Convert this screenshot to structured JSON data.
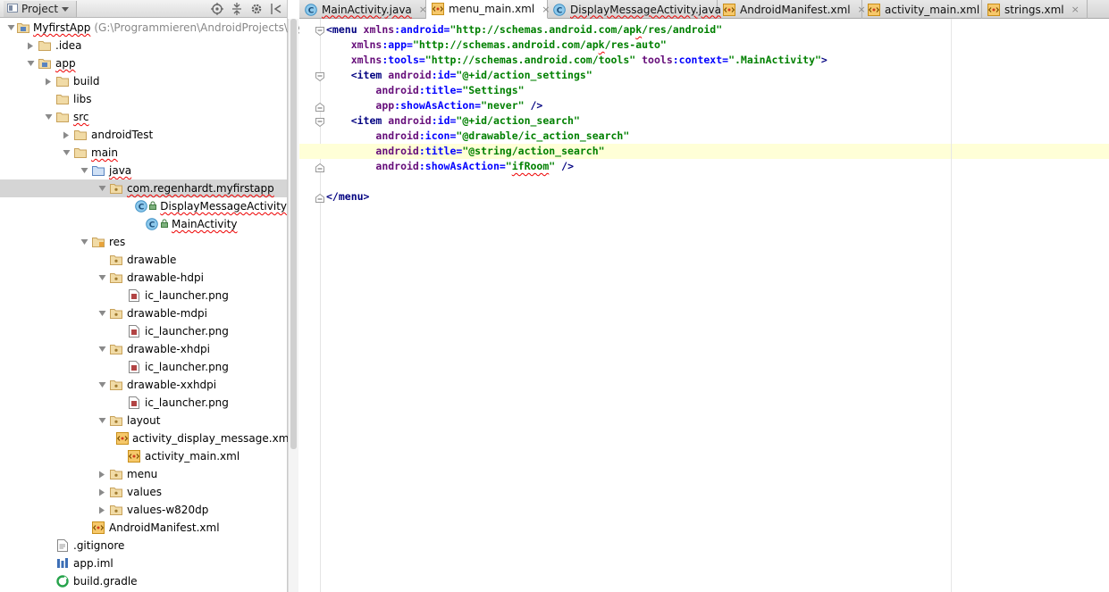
{
  "project_panel": {
    "title": "Project",
    "tools": [
      "target-icon",
      "collapse-icon",
      "gear-icon",
      "hide-icon"
    ]
  },
  "tree": [
    {
      "label": "MyfirstApp",
      "path": "(G:\\Programmieren\\AndroidProjects\\Myf",
      "icon": "module",
      "arrow": "down",
      "indent": 0,
      "squiggle": true
    },
    {
      "label": ".idea",
      "icon": "folder",
      "arrow": "right",
      "indent": 1
    },
    {
      "label": "app",
      "icon": "module",
      "arrow": "down",
      "indent": 1,
      "squiggle": true
    },
    {
      "label": "build",
      "icon": "folder",
      "arrow": "right",
      "indent": 2
    },
    {
      "label": "libs",
      "icon": "folder",
      "arrow": "none",
      "indent": 2
    },
    {
      "label": "src",
      "icon": "folder",
      "arrow": "down",
      "indent": 2,
      "squiggle": true
    },
    {
      "label": "androidTest",
      "icon": "folder",
      "arrow": "right",
      "indent": 3
    },
    {
      "label": "main",
      "icon": "folder",
      "arrow": "down",
      "indent": 3,
      "squiggle": true
    },
    {
      "label": "java",
      "icon": "folder-blue",
      "arrow": "down",
      "indent": 4,
      "squiggle": true
    },
    {
      "label": "com.regenhardt.myfirstapp",
      "icon": "package",
      "arrow": "down",
      "indent": 5,
      "squiggle": true,
      "selected": true
    },
    {
      "label": "DisplayMessageActivity",
      "icon": "class",
      "arrow": "none",
      "indent": 7,
      "squiggle": true,
      "lock": true
    },
    {
      "label": "MainActivity",
      "icon": "class",
      "arrow": "none",
      "indent": 7,
      "squiggle": true,
      "lock": true
    },
    {
      "label": "res",
      "icon": "folder-res",
      "arrow": "down",
      "indent": 4
    },
    {
      "label": "drawable",
      "icon": "package",
      "arrow": "none",
      "indent": 5
    },
    {
      "label": "drawable-hdpi",
      "icon": "package",
      "arrow": "down",
      "indent": 5
    },
    {
      "label": "ic_launcher.png",
      "icon": "image",
      "arrow": "none",
      "indent": 6
    },
    {
      "label": "drawable-mdpi",
      "icon": "package",
      "arrow": "down",
      "indent": 5
    },
    {
      "label": "ic_launcher.png",
      "icon": "image",
      "arrow": "none",
      "indent": 6
    },
    {
      "label": "drawable-xhdpi",
      "icon": "package",
      "arrow": "down",
      "indent": 5
    },
    {
      "label": "ic_launcher.png",
      "icon": "image",
      "arrow": "none",
      "indent": 6
    },
    {
      "label": "drawable-xxhdpi",
      "icon": "package",
      "arrow": "down",
      "indent": 5
    },
    {
      "label": "ic_launcher.png",
      "icon": "image",
      "arrow": "none",
      "indent": 6
    },
    {
      "label": "layout",
      "icon": "package",
      "arrow": "down",
      "indent": 5
    },
    {
      "label": "activity_display_message.xml",
      "icon": "xml",
      "arrow": "none",
      "indent": 6
    },
    {
      "label": "activity_main.xml",
      "icon": "xml",
      "arrow": "none",
      "indent": 6
    },
    {
      "label": "menu",
      "icon": "package",
      "arrow": "right",
      "indent": 5
    },
    {
      "label": "values",
      "icon": "package",
      "arrow": "right",
      "indent": 5
    },
    {
      "label": "values-w820dp",
      "icon": "package",
      "arrow": "right",
      "indent": 5
    },
    {
      "label": "AndroidManifest.xml",
      "icon": "xml",
      "arrow": "none",
      "indent": 4
    },
    {
      "label": ".gitignore",
      "icon": "text",
      "arrow": "none",
      "indent": 2
    },
    {
      "label": "app.iml",
      "icon": "iml",
      "arrow": "none",
      "indent": 2
    },
    {
      "label": "build.gradle",
      "icon": "gradle",
      "arrow": "none",
      "indent": 2
    }
  ],
  "tabs": [
    {
      "label": "MainActivity.java",
      "icon": "class",
      "squiggle": true,
      "active": false
    },
    {
      "label": "menu_main.xml",
      "icon": "xml",
      "squiggle": false,
      "active": true
    },
    {
      "label": "DisplayMessageActivity.java",
      "icon": "class",
      "squiggle": true,
      "active": false
    },
    {
      "label": "AndroidManifest.xml",
      "icon": "xml",
      "squiggle": false,
      "active": false
    },
    {
      "label": "activity_main.xml",
      "icon": "xml",
      "squiggle": false,
      "active": false
    },
    {
      "label": "strings.xml",
      "icon": "xml",
      "squiggle": false,
      "active": false
    }
  ],
  "tab_close_glyph": "×",
  "code_lines": [
    {
      "fold": "open",
      "tokens": [
        [
          "tg",
          "<menu "
        ],
        [
          "ns",
          "xmlns"
        ],
        [
          "an",
          ":android="
        ],
        [
          "av",
          "\"http://schemas.android.com/ap"
        ],
        [
          "av sq",
          "k"
        ],
        [
          "av",
          "/res/android\""
        ]
      ]
    },
    {
      "fold": "",
      "tokens": [
        [
          "pl",
          "    "
        ],
        [
          "ns",
          "xmlns"
        ],
        [
          "an",
          ":app="
        ],
        [
          "av",
          "\"http://schemas.android.com/ap"
        ],
        [
          "av sq",
          "k"
        ],
        [
          "av",
          "/res-auto\""
        ]
      ]
    },
    {
      "fold": "",
      "tokens": [
        [
          "pl",
          "    "
        ],
        [
          "ns",
          "xmlns"
        ],
        [
          "an",
          ":tools="
        ],
        [
          "av",
          "\"http://schemas.android.com/tools\" "
        ],
        [
          "ns",
          "tools"
        ],
        [
          "an",
          ":context="
        ],
        [
          "av",
          "\".MainActivity\""
        ],
        [
          "tg",
          ">"
        ]
      ]
    },
    {
      "fold": "open",
      "tokens": [
        [
          "pl",
          "    "
        ],
        [
          "tg",
          "<item "
        ],
        [
          "ns",
          "android"
        ],
        [
          "an",
          ":id="
        ],
        [
          "av",
          "\"@+id/action_settings\""
        ]
      ]
    },
    {
      "fold": "",
      "tokens": [
        [
          "pl",
          "        "
        ],
        [
          "ns",
          "android"
        ],
        [
          "an",
          ":title="
        ],
        [
          "av",
          "\"Settings\""
        ]
      ]
    },
    {
      "fold": "close",
      "tokens": [
        [
          "pl",
          "        "
        ],
        [
          "ns",
          "app"
        ],
        [
          "an",
          ":showAsAction="
        ],
        [
          "av",
          "\"never\" "
        ],
        [
          "tg",
          "/>"
        ]
      ]
    },
    {
      "fold": "open",
      "tokens": [
        [
          "pl",
          "    "
        ],
        [
          "tg",
          "<item "
        ],
        [
          "ns",
          "android"
        ],
        [
          "an",
          ":id="
        ],
        [
          "av",
          "\"@+id/action_search\""
        ]
      ]
    },
    {
      "fold": "",
      "tokens": [
        [
          "pl",
          "        "
        ],
        [
          "ns",
          "android"
        ],
        [
          "an",
          ":icon="
        ],
        [
          "av",
          "\"@drawable/ic_action_search\""
        ]
      ]
    },
    {
      "fold": "",
      "highlight": true,
      "tokens": [
        [
          "pl",
          "        "
        ],
        [
          "ns",
          "android"
        ],
        [
          "an",
          ":title="
        ],
        [
          "av",
          "\"@string/action_search\""
        ]
      ]
    },
    {
      "fold": "close",
      "tokens": [
        [
          "pl",
          "        "
        ],
        [
          "ns",
          "android"
        ],
        [
          "an",
          ":showAsAction="
        ],
        [
          "av",
          "\""
        ],
        [
          "av sq",
          "ifRoom"
        ],
        [
          "av",
          "\" "
        ],
        [
          "tg",
          "/>"
        ]
      ]
    },
    {
      "fold": "",
      "tokens": []
    },
    {
      "fold": "close",
      "tokens": [
        [
          "tg",
          "</menu>"
        ]
      ]
    }
  ],
  "colors": {
    "tag": "#000080",
    "attribute": "#0000ff",
    "namespace": "#660e7a",
    "value": "#008000",
    "folder": "#c8a25a",
    "selection": "#d5d5d5",
    "current_line": "#ffffd7"
  }
}
